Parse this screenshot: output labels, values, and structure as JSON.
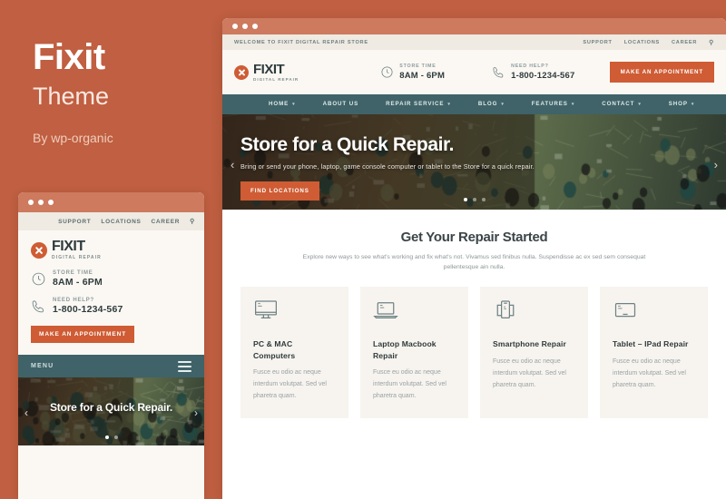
{
  "promo": {
    "title": "Fixit",
    "subtitle": "Theme",
    "author": "By wp-organic"
  },
  "colors": {
    "background": "#c05f41",
    "accent": "#cf5c34",
    "nav": "#3f6368",
    "chrome": "#cd7a5e",
    "card_bg": "#f7f4ef",
    "header_bg": "#fbf8f3"
  },
  "mobile_preview": {
    "topbar": {
      "links": [
        "SUPPORT",
        "LOCATIONS",
        "CAREER"
      ],
      "search_icon": "search-icon"
    },
    "logo": {
      "name": "FIXIT",
      "tagline": "DIGITAL REPAIR",
      "mark": "x-circle-icon"
    },
    "info": [
      {
        "icon": "clock-icon",
        "label": "STORE TIME",
        "value": "8AM - 6PM"
      },
      {
        "icon": "phone-icon",
        "label": "NEED HELP?",
        "value": "1-800-1234-567"
      }
    ],
    "cta": "MAKE AN APPOINTMENT",
    "menu": {
      "label": "MENU",
      "icon": "hamburger-icon"
    },
    "hero": {
      "title": "Store for a Quick Repair.",
      "prev_icon": "chevron-left-icon",
      "next_icon": "chevron-right-icon",
      "dots": 2,
      "active_dot": 0
    }
  },
  "desktop_preview": {
    "topbar": {
      "welcome": "WELCOME TO FIXIT DIGITAL REPAIR STORE",
      "links": [
        "SUPPORT",
        "LOCATIONS",
        "CAREER"
      ],
      "search_icon": "search-icon"
    },
    "logo": {
      "name": "FIXIT",
      "tagline": "DIGITAL REPAIR",
      "mark": "x-circle-icon"
    },
    "info": [
      {
        "icon": "clock-icon",
        "label": "STORE TIME",
        "value": "8AM - 6PM"
      },
      {
        "icon": "phone-icon",
        "label": "NEED HELP?",
        "value": "1-800-1234-567"
      }
    ],
    "cta": "MAKE AN APPOINTMENT",
    "nav": [
      {
        "label": "HOME",
        "caret": true
      },
      {
        "label": "ABOUT US",
        "caret": false
      },
      {
        "label": "REPAIR SERVICE",
        "caret": true
      },
      {
        "label": "BLOG",
        "caret": true
      },
      {
        "label": "FEATURES",
        "caret": true
      },
      {
        "label": "CONTACT",
        "caret": true
      },
      {
        "label": "SHOP",
        "caret": true
      }
    ],
    "hero": {
      "title": "Store for a Quick Repair.",
      "subtitle": "Bring or send your phone, laptop, game console computer or tablet to the Store for a quick repair.",
      "button": "FIND LOCATIONS",
      "prev_icon": "chevron-left-icon",
      "next_icon": "chevron-right-icon",
      "dots": 3,
      "active_dot": 0
    },
    "section": {
      "heading": "Get Your Repair Started",
      "description": "Explore new ways to see what's working and fix what's not. Vivamus sed finibus nulla. Suspendisse ac ex sed sem consequat pellentesque ain nulla."
    },
    "cards": [
      {
        "icon": "desktop-monitor-icon",
        "title": "PC & MAC Computers",
        "body": "Fusce eu odio ac neque interdum volutpat. Sed vel pharetra quam."
      },
      {
        "icon": "laptop-icon",
        "title": "Laptop Macbook Repair",
        "body": "Fusce eu odio ac neque interdum volutpat. Sed vel pharetra quam."
      },
      {
        "icon": "smartphone-icon",
        "title": "Smartphone Repair",
        "body": "Fusce eu odio ac neque interdum volutpat. Sed vel pharetra quam."
      },
      {
        "icon": "tablet-icon",
        "title": "Tablet – IPad Repair",
        "body": "Fusce eu odio ac neque interdum volutpat. Sed vel pharetra quam."
      }
    ]
  }
}
